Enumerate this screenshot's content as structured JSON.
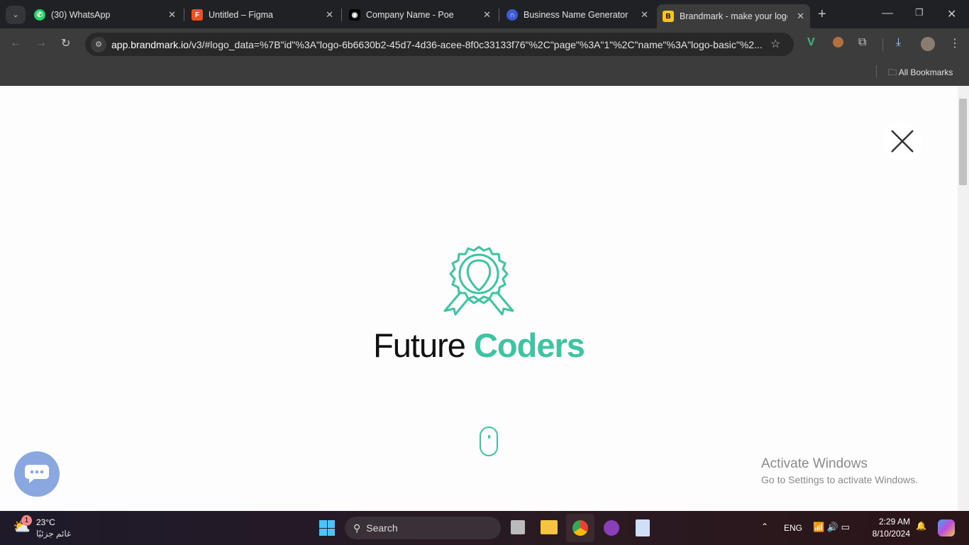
{
  "tabs": [
    {
      "title": "(30) WhatsApp",
      "color": "#25d366",
      "glyph": "✆"
    },
    {
      "title": "Untitled – Figma",
      "color": "#f24e1e",
      "glyph": "F"
    },
    {
      "title": "Company Name - Poe",
      "color": "#5b3fd6",
      "glyph": "◉"
    },
    {
      "title": "Business Name Generator - I",
      "color": "#3b5bdb",
      "glyph": "∩"
    },
    {
      "title": "Brandmark - make your logo",
      "color": "#f5c518",
      "glyph": "B"
    }
  ],
  "address": {
    "host": "app.brandmark.io",
    "path": "/v3/#logo_data=%7B\"id\"%3A\"logo-6b6630b2-45d7-4d36-acee-8f0c33133f76\"%2C\"page\"%3A\"1\"%2C\"name\"%3A\"logo-basic\"%2..."
  },
  "bookmarks": {
    "all": "All Bookmarks"
  },
  "logo": {
    "word1": "Future",
    "word2": "Coders",
    "accent": "#3cc4a3"
  },
  "watermark": {
    "title": "Activate Windows",
    "sub": "Go to Settings to activate Windows."
  },
  "taskbar": {
    "temp": "23°C",
    "weather": "غائم جزئيًا",
    "badge": "1",
    "search": "Search",
    "lang": "ENG",
    "time": "2:29 AM",
    "date": "8/10/2024"
  }
}
